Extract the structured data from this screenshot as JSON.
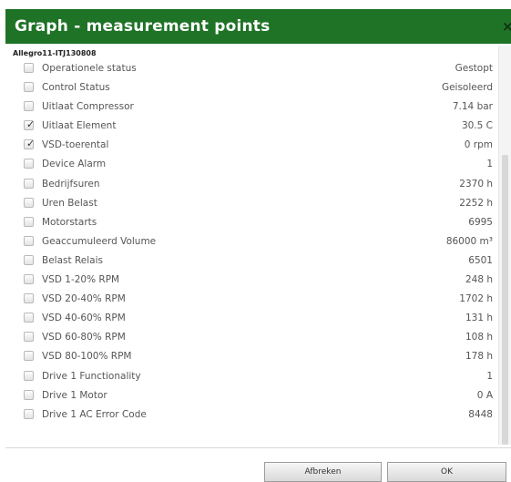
{
  "dialog": {
    "title": "Graph - measurement points",
    "close_glyph": "×",
    "device_name": "Allegro11-ITJ130808"
  },
  "items": [
    {
      "label": "Operationele status",
      "value": "Gestopt",
      "checked": false
    },
    {
      "label": "Control Status",
      "value": "Geisoleerd",
      "checked": false
    },
    {
      "label": "Uitlaat Compressor",
      "value": "7.14 bar",
      "checked": false
    },
    {
      "label": "Uitlaat Element",
      "value": "30.5 C",
      "checked": true
    },
    {
      "label": "VSD-toerental",
      "value": "0 rpm",
      "checked": true
    },
    {
      "label": "Device Alarm",
      "value": "1",
      "checked": false
    },
    {
      "label": "Bedrijfsuren",
      "value": "2370 h",
      "checked": false
    },
    {
      "label": "Uren Belast",
      "value": "2252 h",
      "checked": false
    },
    {
      "label": "Motorstarts",
      "value": "6995",
      "checked": false
    },
    {
      "label": "Geaccumuleerd Volume",
      "value": "86000 m³",
      "checked": false
    },
    {
      "label": "Belast Relais",
      "value": "6501",
      "checked": false
    },
    {
      "label": "VSD 1-20% RPM",
      "value": "248 h",
      "checked": false
    },
    {
      "label": "VSD 20-40% RPM",
      "value": "1702 h",
      "checked": false
    },
    {
      "label": "VSD 40-60% RPM",
      "value": "131 h",
      "checked": false
    },
    {
      "label": "VSD 60-80% RPM",
      "value": "108 h",
      "checked": false
    },
    {
      "label": "VSD 80-100% RPM",
      "value": "178 h",
      "checked": false
    },
    {
      "label": "Drive 1 Functionality",
      "value": "1",
      "checked": false
    },
    {
      "label": "Drive 1 Motor",
      "value": "0 A",
      "checked": false
    },
    {
      "label": "Drive 1 AC Error Code",
      "value": "8448",
      "checked": false
    }
  ],
  "footer": {
    "cancel_label": "Afbreken",
    "ok_label": "OK"
  },
  "colors": {
    "title_bar": "#1f7327",
    "title_text": "#ffffff"
  },
  "icons": {
    "checkbox_checked": "check-icon",
    "close": "close-icon"
  }
}
